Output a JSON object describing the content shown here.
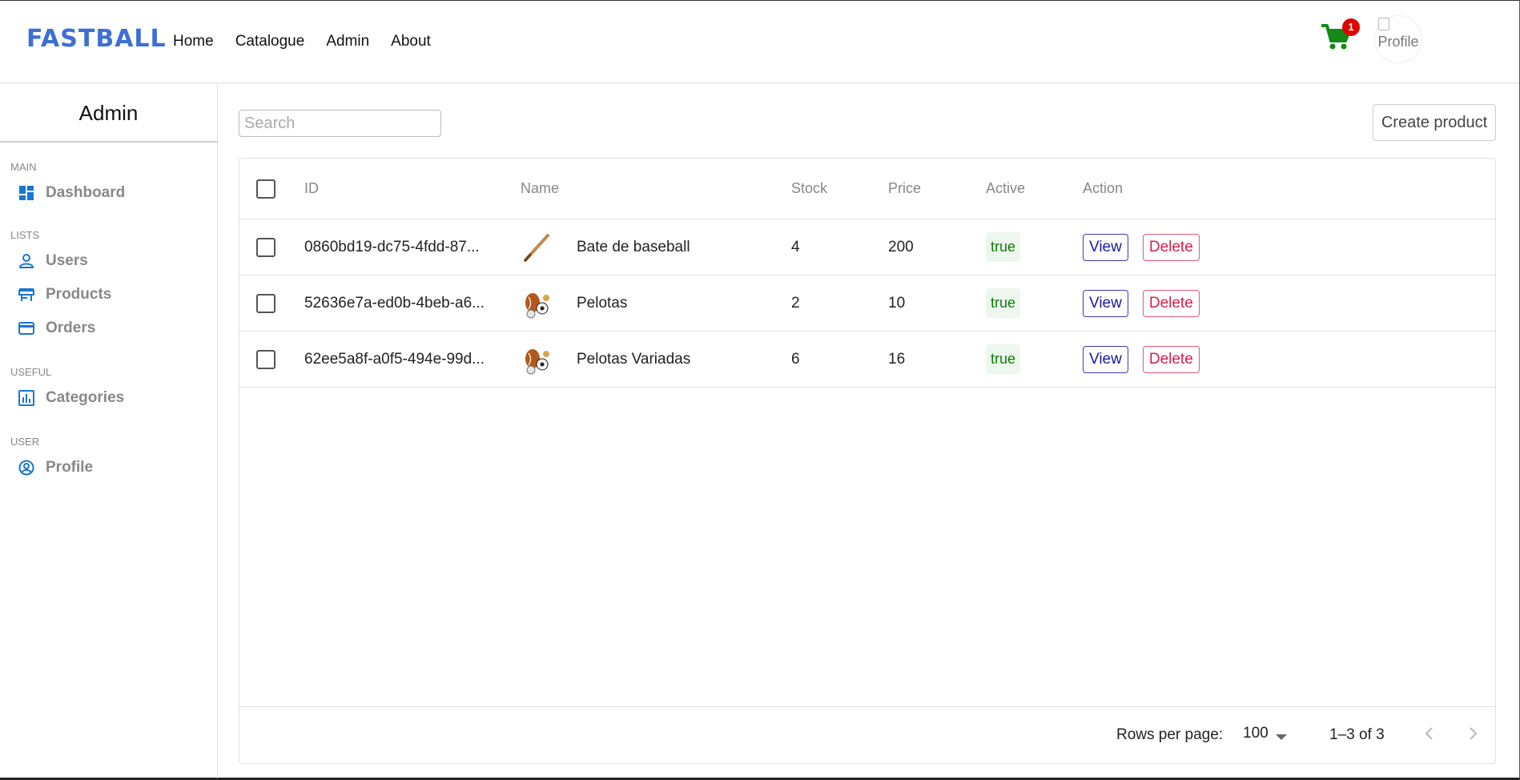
{
  "brand": {
    "logo_text": "FASTBALL",
    "logo_color": "#3d6fd4"
  },
  "nav": {
    "items": [
      "Home",
      "Catalogue",
      "Admin",
      "About"
    ]
  },
  "cart": {
    "count": "1",
    "icon": "shopping-cart-icon",
    "color": "#148a14"
  },
  "profile": {
    "avatar_alt": "Profile"
  },
  "sidebar": {
    "title": "Admin",
    "sections": {
      "main": {
        "label": "MAIN",
        "items": [
          {
            "label": "Dashboard",
            "icon": "dashboard-icon"
          }
        ]
      },
      "lists": {
        "label": "LISTS",
        "items": [
          {
            "label": "Users",
            "icon": "user-icon"
          },
          {
            "label": "Products",
            "icon": "store-icon"
          },
          {
            "label": "Orders",
            "icon": "credit-card-icon"
          }
        ]
      },
      "useful": {
        "label": "USEFUL",
        "items": [
          {
            "label": "Categories",
            "icon": "bar-chart-icon"
          }
        ]
      },
      "user": {
        "label": "USER",
        "items": [
          {
            "label": "Profile",
            "icon": "account-circle-icon"
          }
        ]
      }
    }
  },
  "toolbar": {
    "search_placeholder": "Search",
    "search_value": "",
    "create_label": "Create product"
  },
  "table": {
    "columns": [
      "ID",
      "Name",
      "Stock",
      "Price",
      "Active",
      "Action"
    ],
    "rows": [
      {
        "id": "0860bd19-dc75-4fdd-87...",
        "name": "Bate de baseball",
        "stock": "4",
        "price": "200",
        "active": "true",
        "thumb": "bat",
        "view": "View",
        "delete": "Delete"
      },
      {
        "id": "52636e7a-ed0b-4beb-a6...",
        "name": "Pelotas",
        "stock": "2",
        "price": "10",
        "active": "true",
        "thumb": "balls",
        "view": "View",
        "delete": "Delete"
      },
      {
        "id": "62ee5a8f-a0f5-494e-99d...",
        "name": "Pelotas Variadas",
        "stock": "6",
        "price": "16",
        "active": "true",
        "thumb": "balls",
        "view": "View",
        "delete": "Delete"
      }
    ]
  },
  "pagination": {
    "rows_per_page_label": "Rows per page:",
    "rows_per_page_value": "100",
    "range": "1–3 of 3"
  }
}
